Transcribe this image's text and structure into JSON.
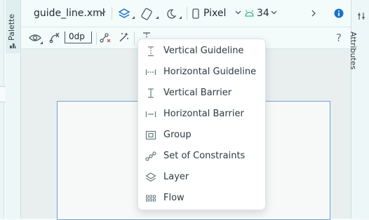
{
  "toolbar": {
    "file_name": "guide_line.xml",
    "device": "Pixel",
    "api_level": "34",
    "margin_value": "0dp",
    "help": "?"
  },
  "side_panels": {
    "left_tab": "Palette",
    "right_tab": "Attributes"
  },
  "menu": {
    "items": [
      {
        "label": "Vertical Guideline",
        "icon": "vertical-guideline-icon"
      },
      {
        "label": "Horizontal Guideline",
        "icon": "horizontal-guideline-icon"
      },
      {
        "label": "Vertical Barrier",
        "icon": "vertical-barrier-icon"
      },
      {
        "label": "Horizontal Barrier",
        "icon": "horizontal-barrier-icon"
      },
      {
        "label": "Group",
        "icon": "group-icon"
      },
      {
        "label": "Set of Constraints",
        "icon": "constraints-set-icon"
      },
      {
        "label": "Layer",
        "icon": "layer-icon"
      },
      {
        "label": "Flow",
        "icon": "flow-icon"
      }
    ]
  },
  "colors": {
    "background": "#f3fbfb",
    "accent": "#1a73c9",
    "android_green": "#3dbb7a",
    "selection_border": "#6aa3d8"
  }
}
